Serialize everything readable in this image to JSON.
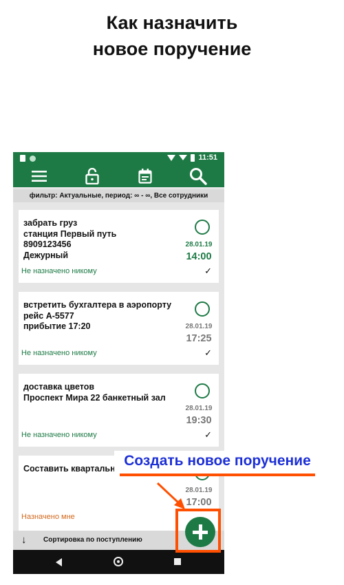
{
  "headline": {
    "line1": "Как назначить",
    "line2": "новое поручение"
  },
  "status_bar": {
    "time": "11:51",
    "battery": "▮"
  },
  "toolbar": {
    "menu_icon": "menu-icon",
    "lock_icon": "lock-icon",
    "calendar_icon": "calendar-icon",
    "search_icon": "search-icon"
  },
  "filter": {
    "text": "фильтр: Актуальные, период: ∞ - ∞, Все сотрудники"
  },
  "tasks": [
    {
      "lines": [
        "забрать груз",
        "станция Первый путь",
        "8909123456",
        "Дежурный"
      ],
      "date": "28.01.19",
      "time": "14:00",
      "assignee": "Не назначено никому",
      "status_color": "#1d7a45"
    },
    {
      "lines": [
        "встретить бухгалтера в аэропорту",
        "рейс А-5577",
        "прибытие 17:20",
        ""
      ],
      "date": "28.01.19",
      "time": "17:25",
      "assignee": "Не назначено никому",
      "status_color": "#777777"
    },
    {
      "lines": [
        "доставка цветов",
        "Проспект Мира 22 банкетный зал",
        "",
        ""
      ],
      "date": "28.01.19",
      "time": "19:30",
      "assignee": "Не назначено никому",
      "status_color": "#777777"
    },
    {
      "lines": [
        "Составить квартальный отчет",
        "",
        "",
        ""
      ],
      "date": "28.01.19",
      "time": "17:00",
      "assignee": "Назначено мне",
      "status_color": "#777777"
    }
  ],
  "check_mark": "✓",
  "sort": {
    "arrow": "↓",
    "label": "Сортировка по поступлению"
  },
  "annotation": {
    "text": "Создать новое поручение"
  },
  "colors": {
    "primary": "#1d7a45",
    "accent": "#ff4f00",
    "annotation_text": "#1c2fd6",
    "assigned_me": "#d2691e"
  }
}
